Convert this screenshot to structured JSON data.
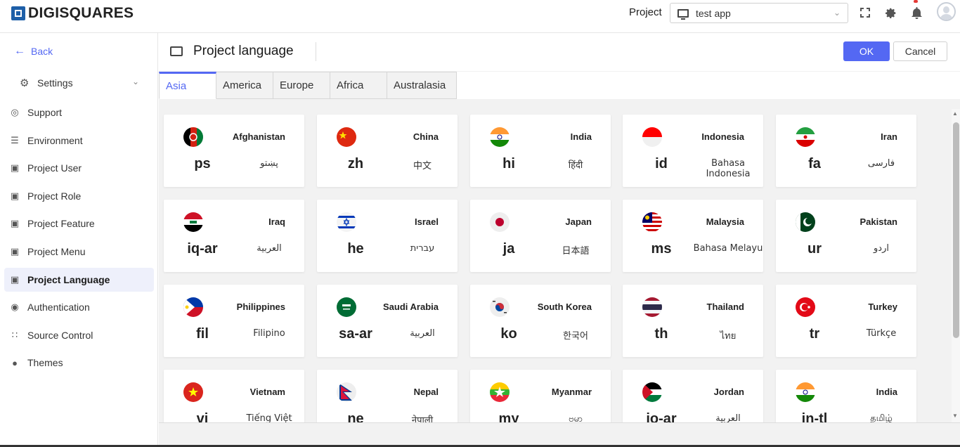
{
  "header": {
    "logo_text": "DIGISQUARES",
    "project_label": "Project",
    "project_value": "test app",
    "icons": [
      "fullscreen-icon",
      "gear-icon",
      "bell-icon",
      "avatar"
    ]
  },
  "sidebar": {
    "back_label": "Back",
    "settings_label": "Settings",
    "items": [
      {
        "label": "Support",
        "icon": "support-icon"
      },
      {
        "label": "Environment",
        "icon": "sliders-icon"
      },
      {
        "label": "Project User",
        "icon": "user-folder-icon"
      },
      {
        "label": "Project Role",
        "icon": "role-folder-icon"
      },
      {
        "label": "Project Feature",
        "icon": "feature-folder-icon"
      },
      {
        "label": "Project Menu",
        "icon": "menu-folder-icon"
      },
      {
        "label": "Project Language",
        "icon": "language-folder-icon"
      },
      {
        "label": "Authentication",
        "icon": "fingerprint-icon"
      },
      {
        "label": "Source Control",
        "icon": "source-control-icon"
      },
      {
        "label": "Themes",
        "icon": "palette-icon"
      }
    ],
    "active_item": "Project Language"
  },
  "page": {
    "title": "Project language",
    "ok_label": "OK",
    "cancel_label": "Cancel"
  },
  "tabs": [
    "Asia",
    "America",
    "Europe",
    "Africa",
    "Australasia"
  ],
  "active_tab": "Asia",
  "languages": [
    {
      "country": "Afghanistan",
      "code": "ps",
      "native": "پښتو"
    },
    {
      "country": "China",
      "code": "zh",
      "native": "中文"
    },
    {
      "country": "India",
      "code": "hi",
      "native": "हिंदी"
    },
    {
      "country": "Indonesia",
      "code": "id",
      "native": "Bahasa Indonesia"
    },
    {
      "country": "Iran",
      "code": "fa",
      "native": "فارسی"
    },
    {
      "country": "Iraq",
      "code": "iq-ar",
      "native": "العربية"
    },
    {
      "country": "Israel",
      "code": "he",
      "native": "עברית"
    },
    {
      "country": "Japan",
      "code": "ja",
      "native": "日本語"
    },
    {
      "country": "Malaysia",
      "code": "ms",
      "native": "Bahasa Melayu"
    },
    {
      "country": "Pakistan",
      "code": "ur",
      "native": "اردو"
    },
    {
      "country": "Philippines",
      "code": "fil",
      "native": "Filipino"
    },
    {
      "country": "Saudi Arabia",
      "code": "sa-ar",
      "native": "العربية"
    },
    {
      "country": "South Korea",
      "code": "ko",
      "native": "한국어"
    },
    {
      "country": "Thailand",
      "code": "th",
      "native": "ไทย"
    },
    {
      "country": "Turkey",
      "code": "tr",
      "native": "Türkçe"
    },
    {
      "country": "Vietnam",
      "code": "vi",
      "native": "Tiếng Việt"
    },
    {
      "country": "Nepal",
      "code": "ne",
      "native": "नेपाली"
    },
    {
      "country": "Myanmar",
      "code": "my",
      "native": "ဗမာ"
    },
    {
      "country": "Jordan",
      "code": "jo-ar",
      "native": "العربية"
    },
    {
      "country": "India",
      "code": "in-tl",
      "native": "தமிழ்"
    }
  ],
  "colors": {
    "accent": "#5468f3",
    "active_nav_bg": "#eef0fb"
  }
}
